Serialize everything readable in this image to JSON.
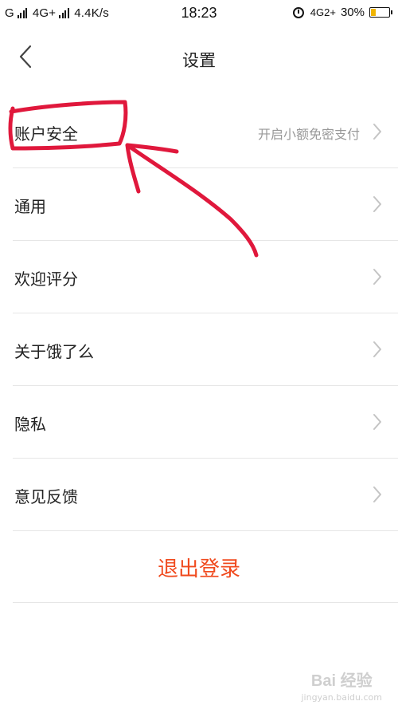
{
  "status_bar": {
    "carrier_left": "G",
    "network_left": "4G+",
    "speed": "4.4K/s",
    "time": "18:23",
    "network_right": "4G2+",
    "battery": "30%"
  },
  "header": {
    "title": "设置"
  },
  "settings": {
    "items": [
      {
        "label": "账户安全",
        "value": "开启小额免密支付"
      },
      {
        "label": "通用"
      },
      {
        "label": "欢迎评分"
      },
      {
        "label": "关于饿了么"
      },
      {
        "label": "隐私"
      },
      {
        "label": "意见反馈"
      }
    ],
    "logout_label": "退出登录"
  },
  "colors": {
    "accent": "#f04a1e",
    "annotation": "#e0183c",
    "divider": "#e6e6e6"
  },
  "watermark": {
    "main": "Bai 经验",
    "sub": "jingyan.baidu.com"
  }
}
